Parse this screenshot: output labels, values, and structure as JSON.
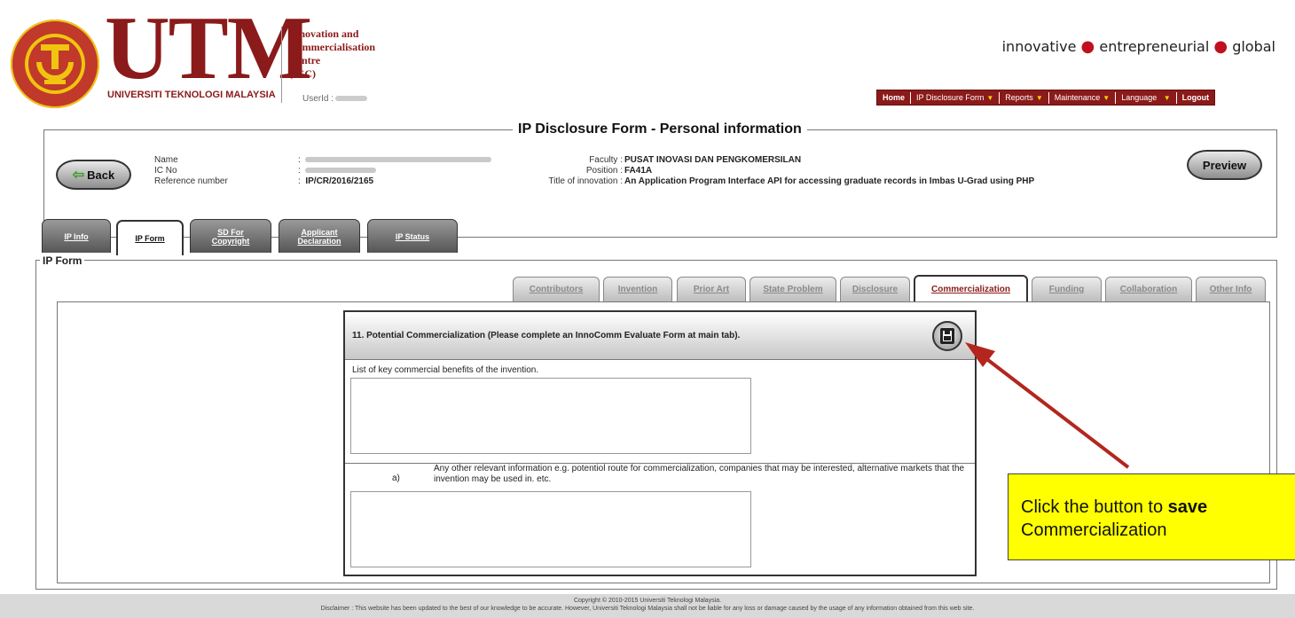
{
  "brand": {
    "logo_word": "UTM",
    "university": "UNIVERSITI TEKNOLOGI MALAYSIA",
    "seal_text": "KERANA TUHAN UNTUK MANUSIA · UNIVERSITI TEKNOLOGI MALAYSIA",
    "centre_line1": "Innovation and",
    "centre_line2": "Commercialisation",
    "centre_line3": "Centre",
    "centre_line4": "(ICC)",
    "userid_label": "UserId :",
    "tagline_1": "innovative",
    "tagline_2": "entrepreneurial",
    "tagline_3": "global",
    "accent_color": "#8b1a1a",
    "dot_color": "#c0101e"
  },
  "topnav": {
    "home": "Home",
    "ip_disclosure_form": "IP Disclosure Form",
    "reports": "Reports",
    "maintenance": "Maintenance",
    "language": "Language",
    "logout": "Logout"
  },
  "personal": {
    "title": "IP Disclosure Form - Personal information",
    "back_label": "Back",
    "preview_label": "Preview",
    "name_label": "Name",
    "ic_label": "IC No",
    "ref_label": "Reference number",
    "ref_value": "IP/CR/2016/2165",
    "faculty_label": "Faculty",
    "faculty_value": "PUSAT INOVASI DAN PENGKOMERSILAN",
    "position_label": "Position",
    "position_value": "FA41A",
    "innovation_label": "Title of innovation",
    "innovation_value": "An Application Program Interface API for accessing graduate records in Imbas U-Grad using PHP",
    "colon": ":"
  },
  "main_tabs": {
    "ip_info": "IP Info",
    "ip_form": "IP Form",
    "sd_line1": "SD For",
    "sd_line2": "Copyright",
    "app_line1": "Applicant",
    "app_line2": "Declaration",
    "ip_status": "IP Status"
  },
  "ip_form_title": "IP Form",
  "sub_tabs": {
    "contributors": "Contributors",
    "invention": "Invention",
    "prior_art": "Prior Art",
    "state_problem": "State Problem",
    "disclosure": "Disclosure",
    "commercialization": "Commercialization",
    "funding": "Funding",
    "collaboration": "Collaboration",
    "other_info": "Other Info"
  },
  "section": {
    "title": "11. Potential Commercialization (Please complete an InnoComm Evaluate Form at main tab).",
    "save_icon": "save-disk-icon",
    "benefits_label": "List of key commercial benefits of the invention.",
    "benefits_value": "",
    "sub_marker": "a)",
    "other_info_text": "Any other relevant information e.g. potentiol route for commercialization, companies that may be interested, alternative markets that the invention may be used in. etc.",
    "other_info_value": ""
  },
  "callout": {
    "line1_prefix": "Click the button to ",
    "line1_bold": "save",
    "line2": "Commercialization",
    "color": "#ffff00",
    "arrow_color": "#b3261e"
  },
  "footer": {
    "copyright": "Copyright © 2010-2015 Universiti Teknologi Malaysia.",
    "disclaimer": "Disclaimer : This website has been updated to the best of our knowledge to be accurate. However, Universiti Teknologi Malaysia shall not be liable for any loss or damage caused by the usage of any information obtained from this web site."
  }
}
